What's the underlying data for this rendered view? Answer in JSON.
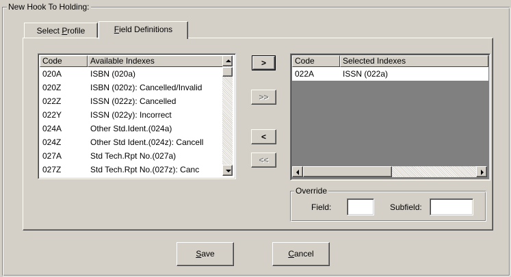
{
  "group": {
    "title": "New Hook To Holding:"
  },
  "tabs": [
    {
      "label": "Select ",
      "mnemonic": "P",
      "label_rest": "rofile",
      "active": false
    },
    {
      "label": "",
      "mnemonic": "F",
      "label_rest": "ield Definitions",
      "active": true
    }
  ],
  "available_list": {
    "columns": [
      "Code",
      "Available Indexes"
    ],
    "rows": [
      {
        "code": "020A",
        "index": "ISBN (020a)"
      },
      {
        "code": "020Z",
        "index": "ISBN (020z): Cancelled/Invalid"
      },
      {
        "code": "022Z",
        "index": "ISSN (022z): Cancelled"
      },
      {
        "code": "022Y",
        "index": "ISSN (022y): Incorrect"
      },
      {
        "code": "024A",
        "index": "Other Std.Ident.(024a)"
      },
      {
        "code": "024Z",
        "index": "Other Std Ident.(024z): Cancell"
      },
      {
        "code": "027A",
        "index": "Std Tech.Rpt No.(027a)"
      },
      {
        "code": "027Z",
        "index": "Std Tech.Rpt No.(027z): Canc"
      }
    ]
  },
  "selected_list": {
    "columns": [
      "Code",
      "Selected Indexes"
    ],
    "rows": [
      {
        "code": "022A",
        "index": "ISSN (022a)"
      }
    ]
  },
  "move_buttons": {
    "add_one": ">",
    "add_all": ">>",
    "remove_one": "<",
    "remove_all": "<<"
  },
  "override": {
    "title": "Override",
    "field_label": "Field:",
    "field_value": "",
    "subfield_label": "Subfield:",
    "subfield_value": ""
  },
  "footer": {
    "save_mnemonic": "S",
    "save_rest": "ave",
    "cancel_mnemonic": "C",
    "cancel_rest": "ancel"
  },
  "icons": {
    "scroll_up": "triangle-up",
    "scroll_down": "triangle-down",
    "scroll_left": "triangle-left",
    "scroll_right": "triangle-right"
  },
  "colors": {
    "face": "#d4d0c8",
    "shadow": "#808080",
    "highlight": "#ffffff",
    "empty_list_area": "#808080"
  }
}
